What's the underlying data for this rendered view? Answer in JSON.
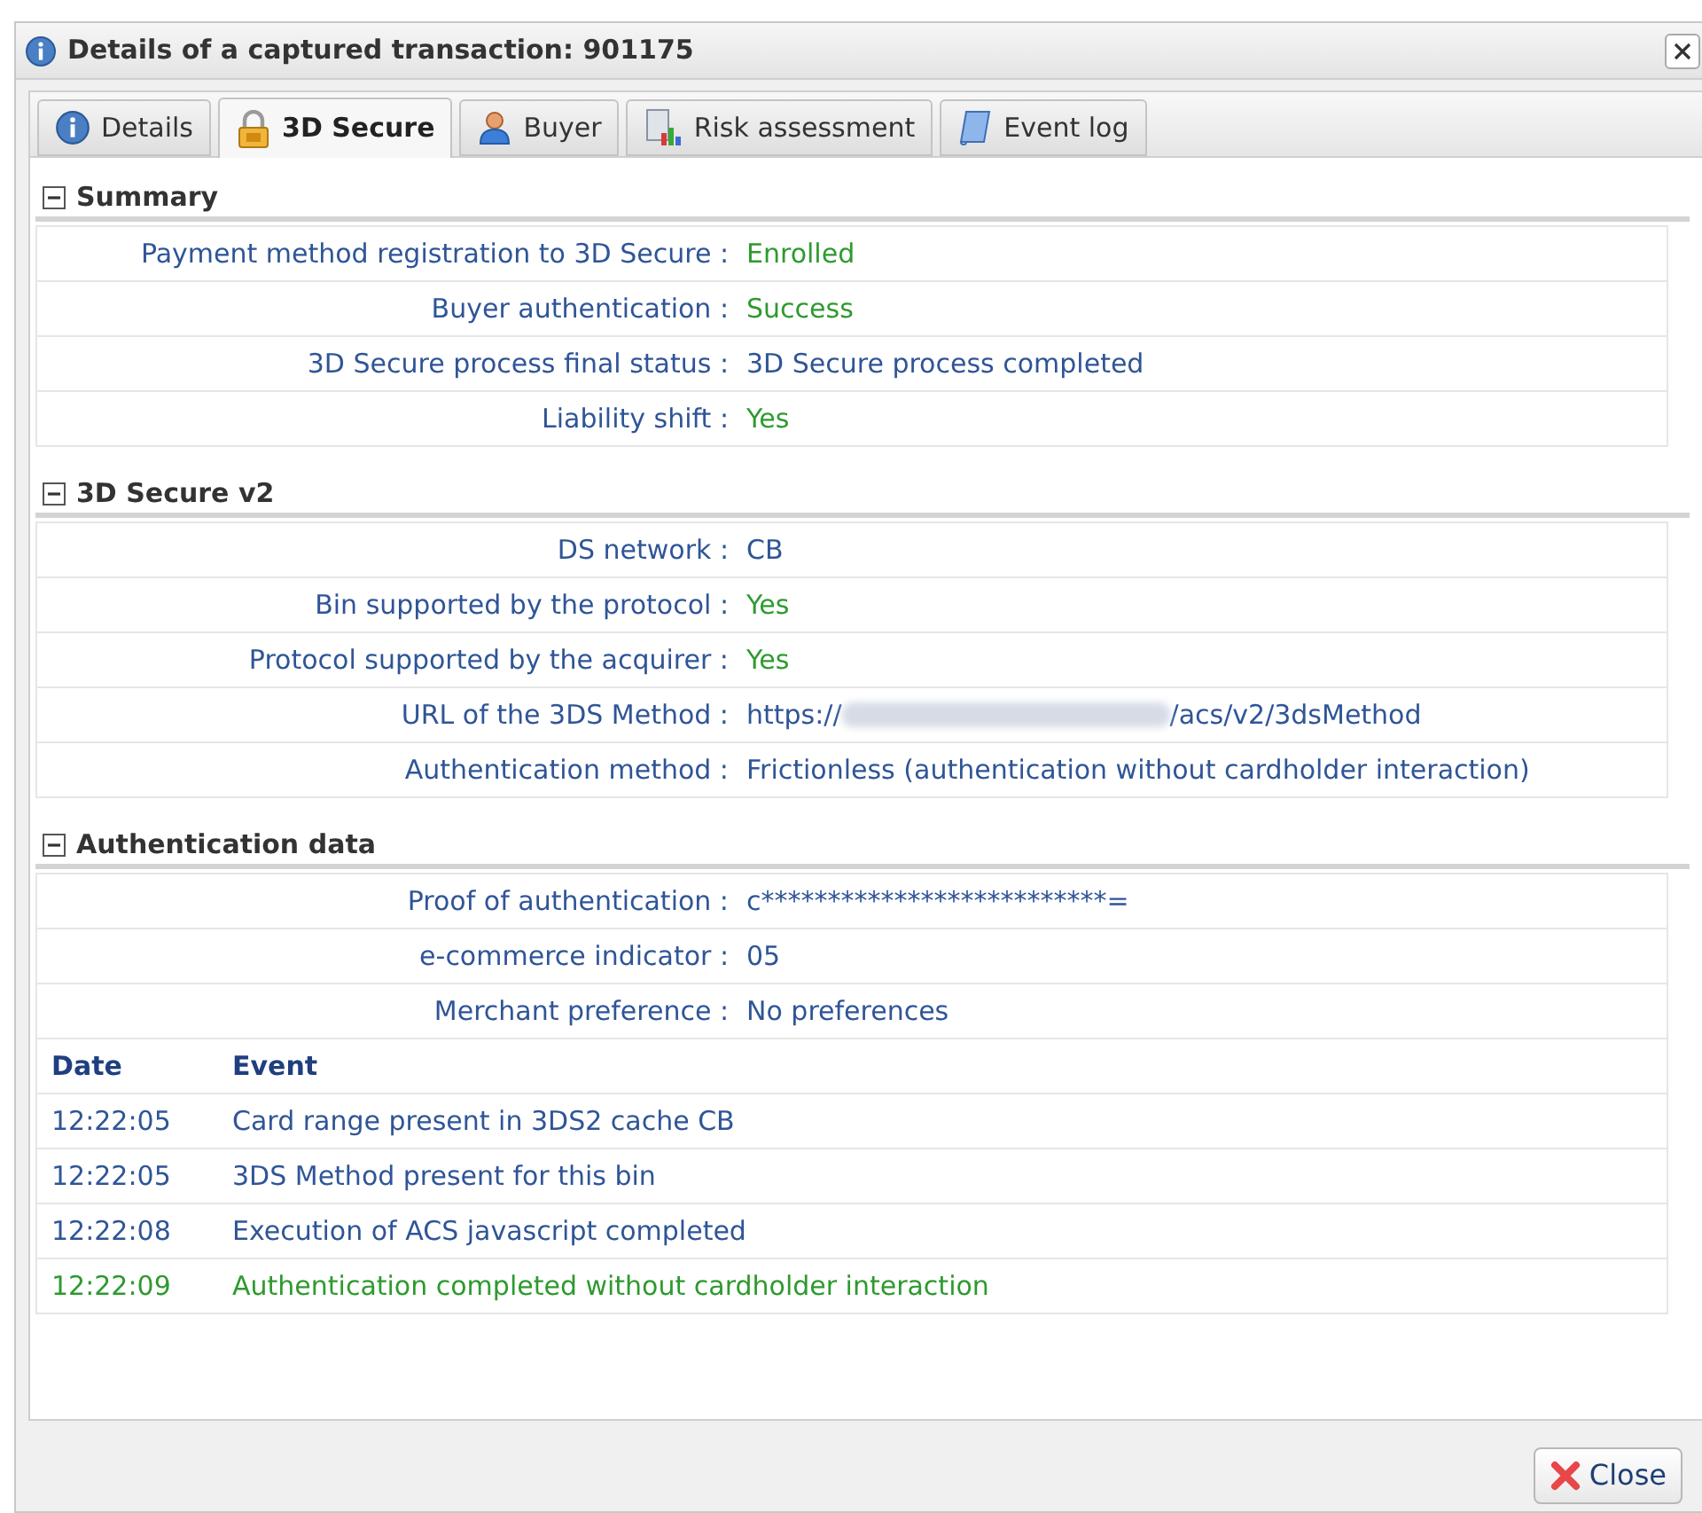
{
  "window": {
    "title": "Details of a captured transaction: 901175"
  },
  "tabs": [
    {
      "label": "Details",
      "kind": "info",
      "selected": false
    },
    {
      "label": "3D Secure",
      "kind": "secure",
      "selected": true
    },
    {
      "label": "Buyer",
      "kind": "buyer",
      "selected": false
    },
    {
      "label": "Risk assessment",
      "kind": "risk",
      "selected": false
    },
    {
      "label": "Event log",
      "kind": "log",
      "selected": false
    }
  ],
  "sections": [
    {
      "title": "Summary",
      "expanded": true,
      "rows": [
        {
          "label": "Payment method registration to 3D Secure :",
          "value": "Enrolled",
          "positive": true
        },
        {
          "label": "Buyer authentication :",
          "value": "Success",
          "positive": true
        },
        {
          "label": "3D Secure process final status :",
          "value": "3D Secure process completed",
          "positive": false
        },
        {
          "label": "Liability shift :",
          "value": "Yes",
          "positive": true
        }
      ]
    },
    {
      "title": "3D Secure v2",
      "expanded": true,
      "rows": [
        {
          "label": "DS network :",
          "value": "CB",
          "positive": false
        },
        {
          "label": "Bin supported by the protocol :",
          "value": "Yes",
          "positive": true
        },
        {
          "label": "Protocol supported by the acquirer :",
          "value": "Yes",
          "positive": true
        },
        {
          "label": "URL of the 3DS Method :",
          "value": "https://",
          "redacted": true,
          "value_end": "/acs/v2/3dsMethod",
          "positive": false
        },
        {
          "label": "Authentication method :",
          "value": "Frictionless (authentication without cardholder interaction)",
          "positive": false
        }
      ]
    },
    {
      "title": "Authentication data",
      "expanded": true,
      "rows": [
        {
          "label": "Proof of authentication :",
          "value": "c**************************=",
          "positive": false
        },
        {
          "label": "e-commerce indicator :",
          "value": "05",
          "positive": false
        },
        {
          "label": "Merchant preference :",
          "value": "No preferences",
          "positive": false
        }
      ],
      "events": {
        "columns": [
          "Date",
          "Event"
        ],
        "rows": [
          {
            "date": "12:22:05",
            "event": "Card range present in 3DS2 cache CB",
            "highlight": false
          },
          {
            "date": "12:22:05",
            "event": "3DS Method present for this bin",
            "highlight": false
          },
          {
            "date": "12:22:08",
            "event": "Execution of ACS javascript completed",
            "highlight": false
          },
          {
            "date": "12:22:09",
            "event": "Authentication completed without cardholder interaction",
            "highlight": true
          }
        ]
      }
    }
  ],
  "buttons": [
    {
      "label": "Close"
    }
  ]
}
